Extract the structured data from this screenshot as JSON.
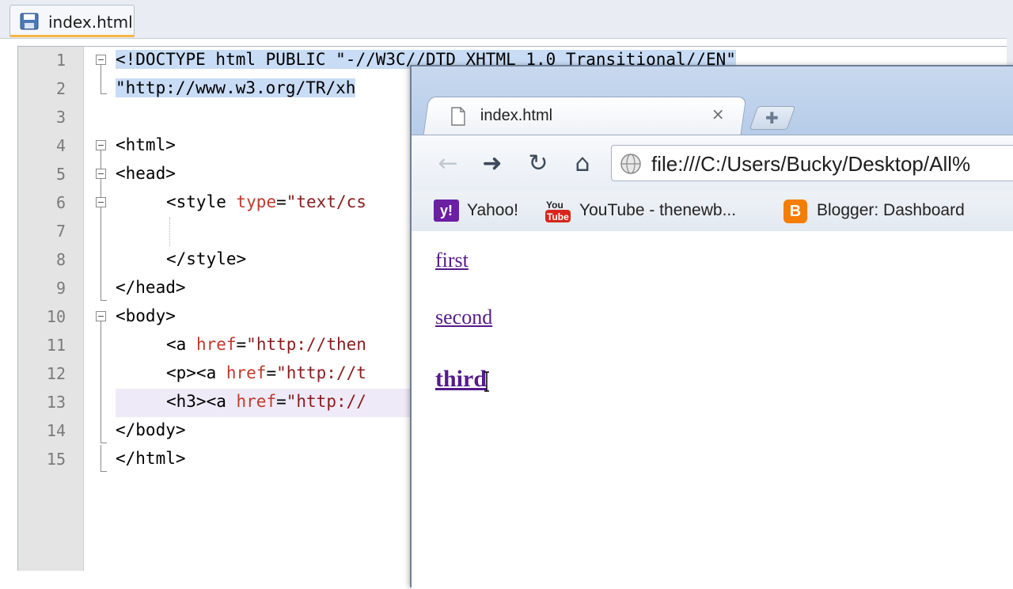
{
  "editor": {
    "tab_label": "index.html",
    "lines": [
      {
        "n": "1"
      },
      {
        "n": "2"
      },
      {
        "n": "3"
      },
      {
        "n": "4"
      },
      {
        "n": "5"
      },
      {
        "n": "6"
      },
      {
        "n": "7"
      },
      {
        "n": "8"
      },
      {
        "n": "9"
      },
      {
        "n": "10"
      },
      {
        "n": "11"
      },
      {
        "n": "12"
      },
      {
        "n": "13"
      },
      {
        "n": "14"
      },
      {
        "n": "15"
      }
    ],
    "code": {
      "l1_a": "<!DOCTYPE html PUBLIC \"",
      "l1_b": "-//W3C//DTD XHTML 1.0 Transitional//EN\"",
      "l2": "\"http://www.w3.org/TR/xh",
      "l4": "<html>",
      "l5": "<head>",
      "l6_tag": "<style ",
      "l6_attr": "type",
      "l6_eq": "=",
      "l6_str": "\"text/cs",
      "l8": "</style>",
      "l9": "</head>",
      "l10": "<body>",
      "l11_tag": "<a ",
      "l11_attr": "href",
      "l11_eq": "=",
      "l11_str": "\"http://then",
      "l12_tag": "<p><a ",
      "l12_attr": "href",
      "l12_eq": "=",
      "l12_str": "\"http://t",
      "l13_tag": "<h3><a ",
      "l13_attr": "href",
      "l13_eq": "=",
      "l13_str": "\"http://",
      "l14": "</body>",
      "l15": "</html>"
    }
  },
  "browser": {
    "tab_title": "index.html",
    "tab_close": "×",
    "new_tab": "✚",
    "nav": {
      "back": "←",
      "forward": "➜",
      "reload": "↻",
      "home": "⌂"
    },
    "address": "file:///C:/Users/Bucky/Desktop/All%",
    "bookmarks": [
      {
        "icon": "y!",
        "label": "Yahoo!"
      },
      {
        "icon": "youtube",
        "label": "YouTube - thenewb..."
      },
      {
        "icon": "B",
        "label": "Blogger: Dashboard"
      }
    ],
    "page": {
      "links": [
        "first",
        "second",
        "third"
      ]
    }
  },
  "colors": {
    "visited_link": "#551a8b",
    "selection": "#c9dcf5",
    "attribute": "#c0392b"
  }
}
